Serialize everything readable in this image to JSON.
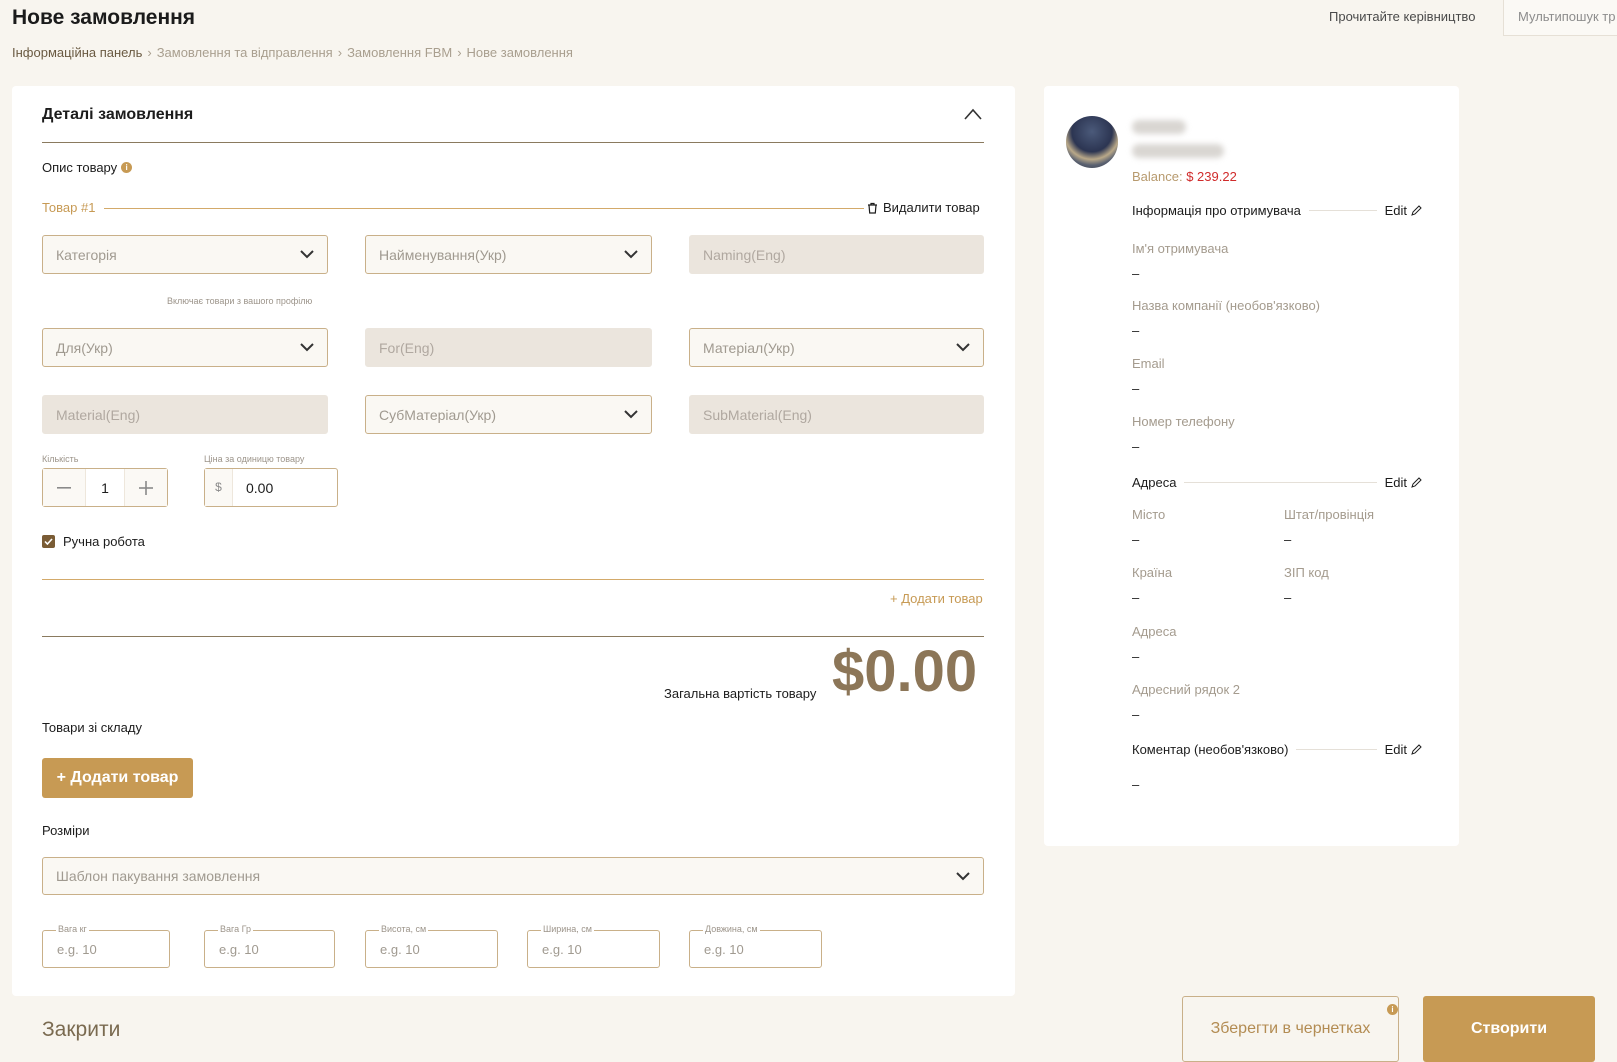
{
  "header": {
    "title": "Нове замовлення",
    "guide_link": "Прочитайте керівництво",
    "multisearch": "Мультипошук тр"
  },
  "breadcrumb": [
    "Інформаційна панель",
    "Замовлення та відправлення",
    "Замовлення FBM",
    "Нове замовлення"
  ],
  "order": {
    "section_title": "Деталі замовлення",
    "product_desc_label": "Опис товару",
    "item_label": "Товар #1",
    "delete_item": "Видалити товар",
    "fields": {
      "category": "Категорія",
      "name_ukr": "Найменування(Укр)",
      "naming_eng": "Naming(Eng)",
      "category_hint": "Включає товари з вашого профілю",
      "for_ukr": "Для(Укр)",
      "for_eng": "For(Eng)",
      "material_ukr": "Матеріал(Укр)",
      "material_eng": "Material(Eng)",
      "submaterial_ukr": "СубМатеріал(Укр)",
      "submaterial_eng": "SubMaterial(Eng)"
    },
    "quantity_label": "Кількість",
    "quantity": "1",
    "unit_price_label": "Ціна за одиницю товару",
    "currency": "$",
    "unit_price": "0.00",
    "handmade_label": "Ручна робота",
    "handmade_checked": true,
    "add_item_link": "+ Додати товар",
    "total_label": "Загальна вартість товару",
    "total_value": "$0.00",
    "stock_title": "Товари зі складу",
    "stock_add_button": "+ Додати товар",
    "sizes_title": "Розміри",
    "packaging_template": "Шаблон пакування замовлення",
    "dimensions": [
      {
        "label": "Вага кг",
        "placeholder": "e.g. 10"
      },
      {
        "label": "Вага Гр",
        "placeholder": "e.g. 10"
      },
      {
        "label": "Висота, см",
        "placeholder": "e.g. 10"
      },
      {
        "label": "Ширина, см",
        "placeholder": "e.g. 10"
      },
      {
        "label": "Довжина, см",
        "placeholder": "e.g. 10"
      }
    ]
  },
  "footer": {
    "close": "Закрити",
    "save_draft": "Зберегти в чернетках",
    "create": "Створити"
  },
  "recipient": {
    "balance_label": "Balance:",
    "balance_value": "$ 239.22",
    "info_title": "Інформація про отримувача",
    "edit": "Edit",
    "fields": [
      {
        "label": "Ім'я отримувача",
        "value": "–"
      },
      {
        "label": "Назва компанії (необов'язково)",
        "value": "–"
      },
      {
        "label": "Email",
        "value": "–"
      },
      {
        "label": "Номер телефону",
        "value": "–"
      }
    ],
    "address_title": "Адреса",
    "address": {
      "city_label": "Місто",
      "city_value": "–",
      "state_label": "Штат/провінція",
      "state_value": "–",
      "country_label": "Країна",
      "country_value": "–",
      "zip_label": "ЗІП код",
      "zip_value": "–",
      "address_label": "Адреса",
      "address_value": "–",
      "address2_label": "Адресний рядок 2",
      "address2_value": "–"
    },
    "comment_title": "Коментар (необов'язково)",
    "comment_value": "–"
  },
  "colors": {
    "accent": "#c79a54",
    "accent_dark": "#8c7658",
    "danger": "#d02b2b",
    "background": "#f8f5ef"
  },
  "icons": [
    "chevron-up-icon",
    "chevron-down-icon",
    "trash-icon",
    "info-icon",
    "minus-icon",
    "plus-icon",
    "check-icon",
    "pencil-icon"
  ]
}
